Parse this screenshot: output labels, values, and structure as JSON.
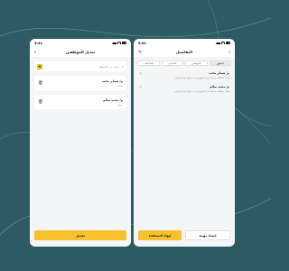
{
  "left_screen": {
    "status_time": "9:41",
    "title": "تعديل الموظفين",
    "search_placeholder": "ابحث عن الموظف",
    "employees": [
      {
        "name": "م/ هشام محمد",
        "role": "مصمم"
      },
      {
        "name": "م/ محمد سالم",
        "role": "مطور"
      }
    ],
    "save_label": "تعديل"
  },
  "right_screen": {
    "status_time": "9:41",
    "title": "التفاصيل",
    "tabs": [
      "الملاحظات",
      "التفاصيل",
      "الموظفين",
      "التعليق"
    ],
    "active_tab_index": 3,
    "comments": [
      {
        "name": "م/ هشام محمد",
        "text": "هناك مشكلة بسيطة في الموقع يجب تعديلها قبل التسليم"
      },
      {
        "name": "م/ محمد سالم",
        "text": "هناك مشكلة بسيطة في الموقع يجب تعديلها قبل التسليم"
      }
    ],
    "primary_label": "إنهاء المشاهدة",
    "secondary_label": "إنشاء مهمة"
  },
  "colors": {
    "background": "#2f5a63",
    "accent": "#f7c22c"
  }
}
